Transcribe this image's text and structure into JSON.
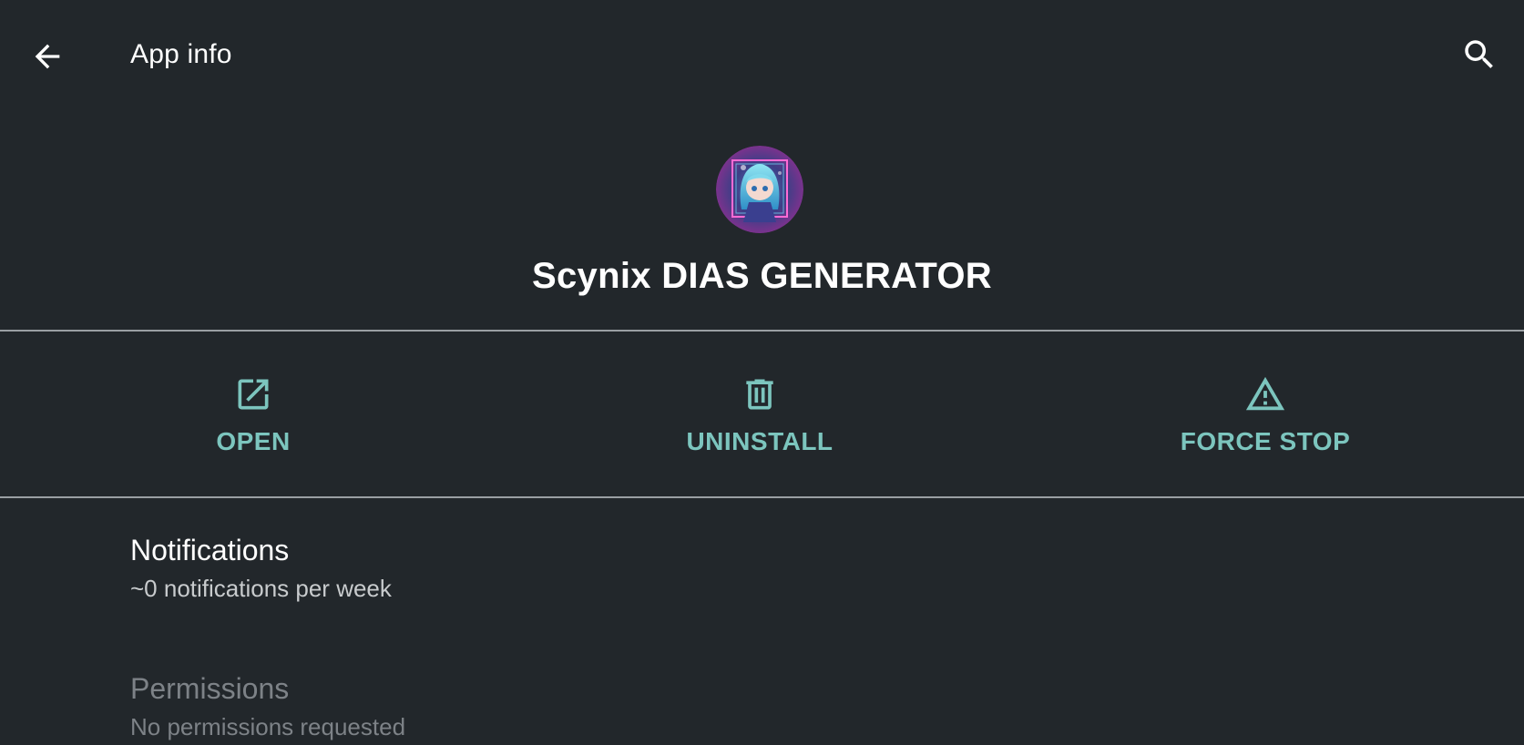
{
  "topbar": {
    "title": "App info",
    "back_icon": "arrow-left-icon",
    "search_icon": "search-icon"
  },
  "app": {
    "name": "Scynix DIAS GENERATOR",
    "icon": "app-icon-anime-character"
  },
  "actions": [
    {
      "label": "OPEN",
      "icon": "open-external-icon"
    },
    {
      "label": "UNINSTALL",
      "icon": "trash-icon"
    },
    {
      "label": "FORCE STOP",
      "icon": "warning-triangle-icon"
    }
  ],
  "items": {
    "notifications": {
      "title": "Notifications",
      "subtitle": "~0 notifications per week"
    },
    "permissions": {
      "title": "Permissions",
      "subtitle": "No permissions requested"
    }
  },
  "colors": {
    "background": "#22272b",
    "accent": "#7cc5be",
    "divider": "#9a9fa3",
    "text_primary": "#ffffff",
    "text_disabled": "#7d8287"
  }
}
